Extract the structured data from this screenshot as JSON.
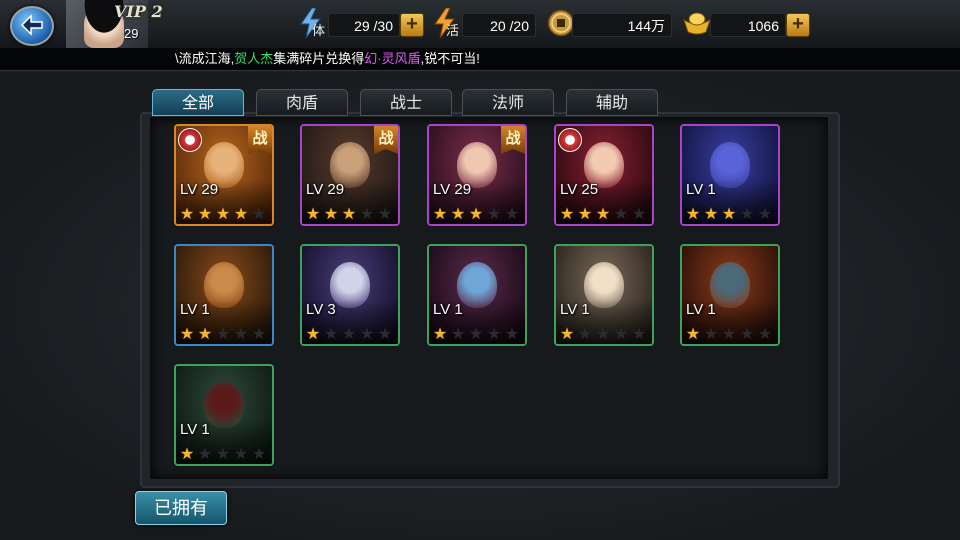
{
  "player": {
    "vip": "VIP 2",
    "level": "29"
  },
  "resources": {
    "stamina": {
      "label": "体",
      "value": "29 /30"
    },
    "energy": {
      "label": "活",
      "value": "20 /20"
    },
    "coins": {
      "value": "144万"
    },
    "gold": {
      "value": "1066"
    }
  },
  "ticker": {
    "prefix": "\\流成江海,",
    "name": "贺人杰",
    "middle": "集满碎片兑换得",
    "item": "幻·灵风盾",
    "suffix": ",锐不可当!"
  },
  "tabs": [
    "全部",
    "肉盾",
    "战士",
    "法师",
    "辅助"
  ],
  "active_tab": "全部",
  "heroes": [
    {
      "level": "LV 29",
      "stars": 4,
      "frame": "orange",
      "tag": "战",
      "badge": true
    },
    {
      "level": "LV 29",
      "stars": 3,
      "frame": "purple",
      "tag": "战",
      "badge": false
    },
    {
      "level": "LV 29",
      "stars": 3,
      "frame": "purple",
      "tag": "战",
      "badge": false
    },
    {
      "level": "LV 25",
      "stars": 3,
      "frame": "purple",
      "tag": "",
      "badge": true
    },
    {
      "level": "LV 1",
      "stars": 3,
      "frame": "purple",
      "tag": "",
      "badge": false
    },
    {
      "level": "LV 1",
      "stars": 2,
      "frame": "blue",
      "tag": "",
      "badge": false
    },
    {
      "level": "LV 3",
      "stars": 1,
      "frame": "green",
      "tag": "",
      "badge": false
    },
    {
      "level": "LV 1",
      "stars": 1,
      "frame": "green",
      "tag": "",
      "badge": false
    },
    {
      "level": "LV 1",
      "stars": 1,
      "frame": "green",
      "tag": "",
      "badge": false
    },
    {
      "level": "LV 1",
      "stars": 1,
      "frame": "green",
      "tag": "",
      "badge": false
    },
    {
      "level": "LV 1",
      "stars": 1,
      "frame": "green",
      "tag": "",
      "badge": false
    }
  ],
  "owned_button": "已拥有",
  "icons": {
    "back": "back-arrow-icon",
    "stamina": "lightning-icon",
    "energy": "lightning-icon",
    "coins": "coin-icon",
    "gold": "gold-ingot-icon",
    "plus": "plus-icon",
    "star": "star-icon"
  },
  "colors": {
    "tab_active": "#2d6a86",
    "ticker_name": "#36e06a",
    "ticker_item": "#e05cf2",
    "star": "#f6b52a"
  }
}
